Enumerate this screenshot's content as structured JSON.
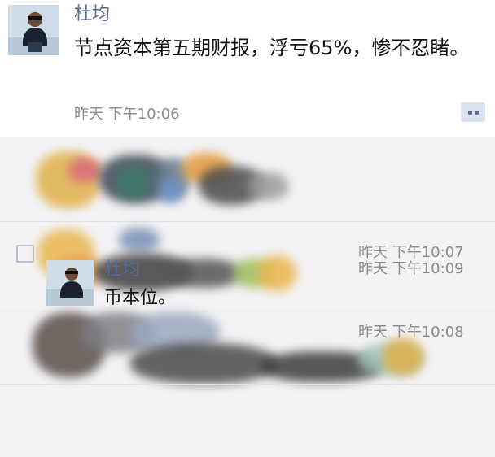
{
  "post": {
    "author": "杜均",
    "text": "节点资本第五期财报，浮亏65%，惨不忍睹。",
    "time": "昨天 下午10:06"
  },
  "comments": [
    {
      "time": "昨天 下午10:07"
    },
    {
      "time": "昨天 下午10:08"
    },
    {
      "author": "杜均",
      "text": "币本位。",
      "time": "昨天 下午10:09"
    }
  ],
  "icons": {
    "comment_button": "comment-dots-icon",
    "comment_section": "comment-icon"
  },
  "colors": {
    "name": "#576b95",
    "time": "#8a8a8a",
    "panel": "#f3f3f5"
  }
}
